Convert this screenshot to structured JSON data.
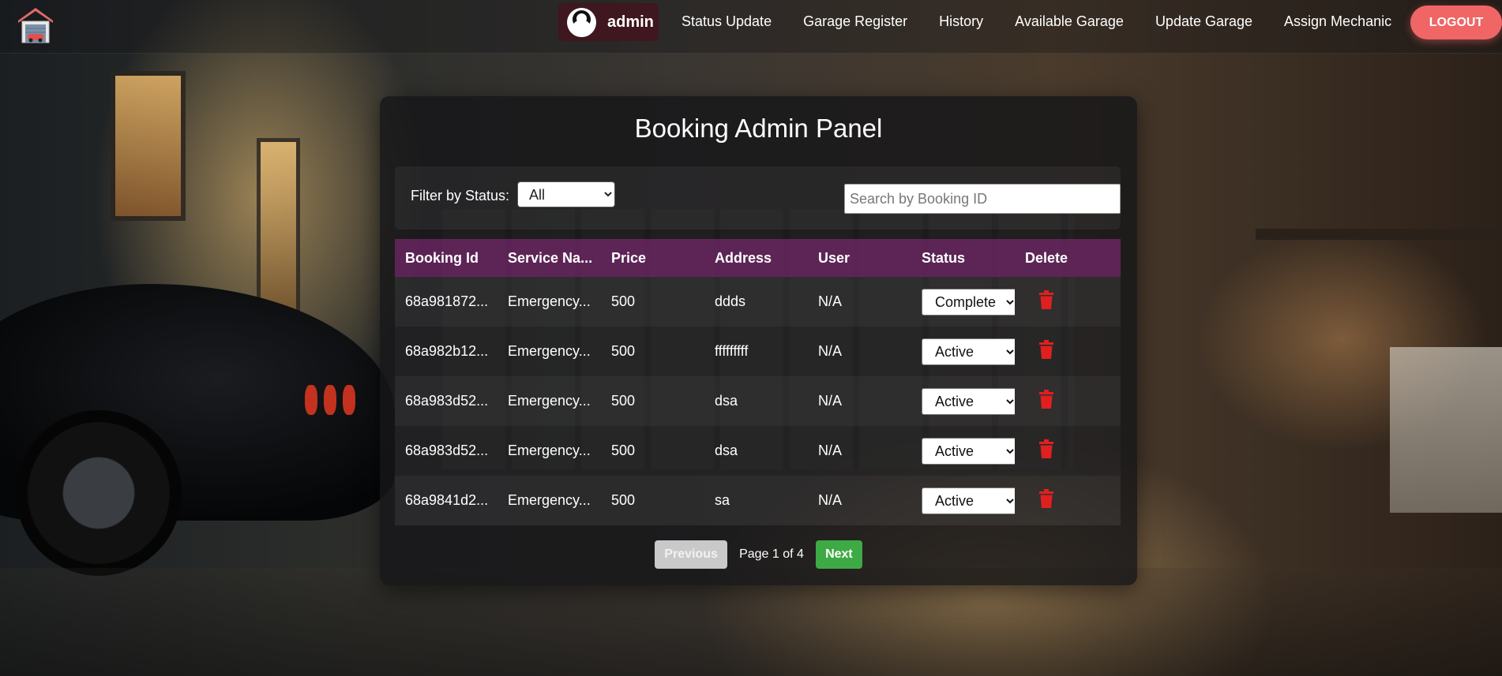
{
  "nav": {
    "username": "admin",
    "links": [
      "Status Update",
      "Garage Register",
      "History",
      "Available Garage",
      "Update Garage",
      "Assign Mechanic"
    ],
    "logout_label": "LOGOUT"
  },
  "panel": {
    "title": "Booking Admin Panel",
    "filter_label": "Filter by Status:",
    "filter_value": "All",
    "search_placeholder": "Search by Booking ID"
  },
  "table": {
    "headers": [
      "Booking Id",
      "Service Na...",
      "Price",
      "Address",
      "User",
      "Status",
      "Delete"
    ],
    "rows": [
      {
        "id": "68a981872...",
        "service": "Emergency...",
        "price": "500",
        "address": "ddds",
        "user": "N/A",
        "status": "Complete"
      },
      {
        "id": "68a982b12...",
        "service": "Emergency...",
        "price": "500",
        "address": "fffffffff",
        "user": "N/A",
        "status": "Active"
      },
      {
        "id": "68a983d52...",
        "service": "Emergency...",
        "price": "500",
        "address": "dsa",
        "user": "N/A",
        "status": "Active"
      },
      {
        "id": "68a983d52...",
        "service": "Emergency...",
        "price": "500",
        "address": "dsa",
        "user": "N/A",
        "status": "Active"
      },
      {
        "id": "68a9841d2...",
        "service": "Emergency...",
        "price": "500",
        "address": "sa",
        "user": "N/A",
        "status": "Active"
      }
    ]
  },
  "pagination": {
    "prev_label": "Previous",
    "page_info": "Page 1 of 4",
    "next_label": "Next"
  },
  "colors": {
    "logout": "#f06666",
    "header_row": "#78286e",
    "next": "#3eaa45",
    "delete_icon": "#e02020"
  }
}
